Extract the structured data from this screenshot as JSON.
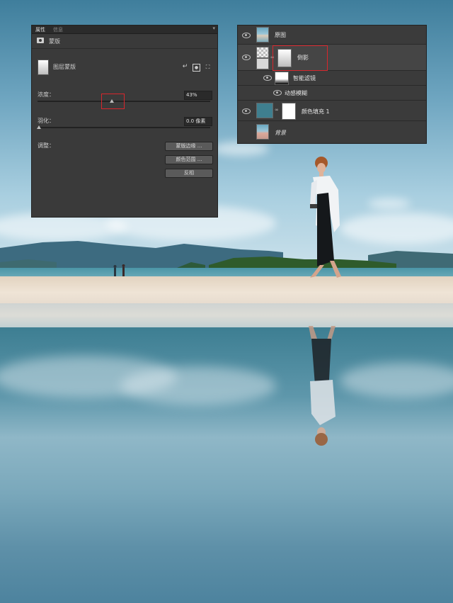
{
  "colors": {
    "panel_bg": "#3a3a3a",
    "highlight": "#d8262c",
    "button_bg": "#5a5a5a"
  },
  "properties_panel": {
    "tabs": [
      "属性",
      "信息"
    ],
    "section_title": "蒙版",
    "mask_type_label": "图层蒙版",
    "icons": [
      "pixel-mask-icon",
      "vector-mask-icon",
      "mask-options-icon"
    ],
    "density": {
      "label": "浓度：",
      "value": "43%",
      "level": 0.43
    },
    "feather": {
      "label": "羽化：",
      "value": "0.0 像素",
      "level": 0.0
    },
    "refine_label": "调整：",
    "buttons": [
      "蒙版边缘 ...",
      "颜色范围 ...",
      "反相"
    ]
  },
  "layers_panel": {
    "layers": [
      {
        "name": "原图",
        "visible": true,
        "thumb": "photo"
      },
      {
        "name": "倒影",
        "visible": true,
        "thumb": "mask",
        "selected": true
      },
      {
        "name": "智能滤镜",
        "visible": true,
        "thumb": "filter-mask",
        "sub": true
      },
      {
        "name": "动感模糊",
        "visible": true,
        "sub": true
      },
      {
        "name": "颜色填充 1",
        "visible": true,
        "thumb": "fill"
      },
      {
        "name": "背景",
        "visible": false,
        "thumb": "photo",
        "italic": true
      }
    ]
  }
}
